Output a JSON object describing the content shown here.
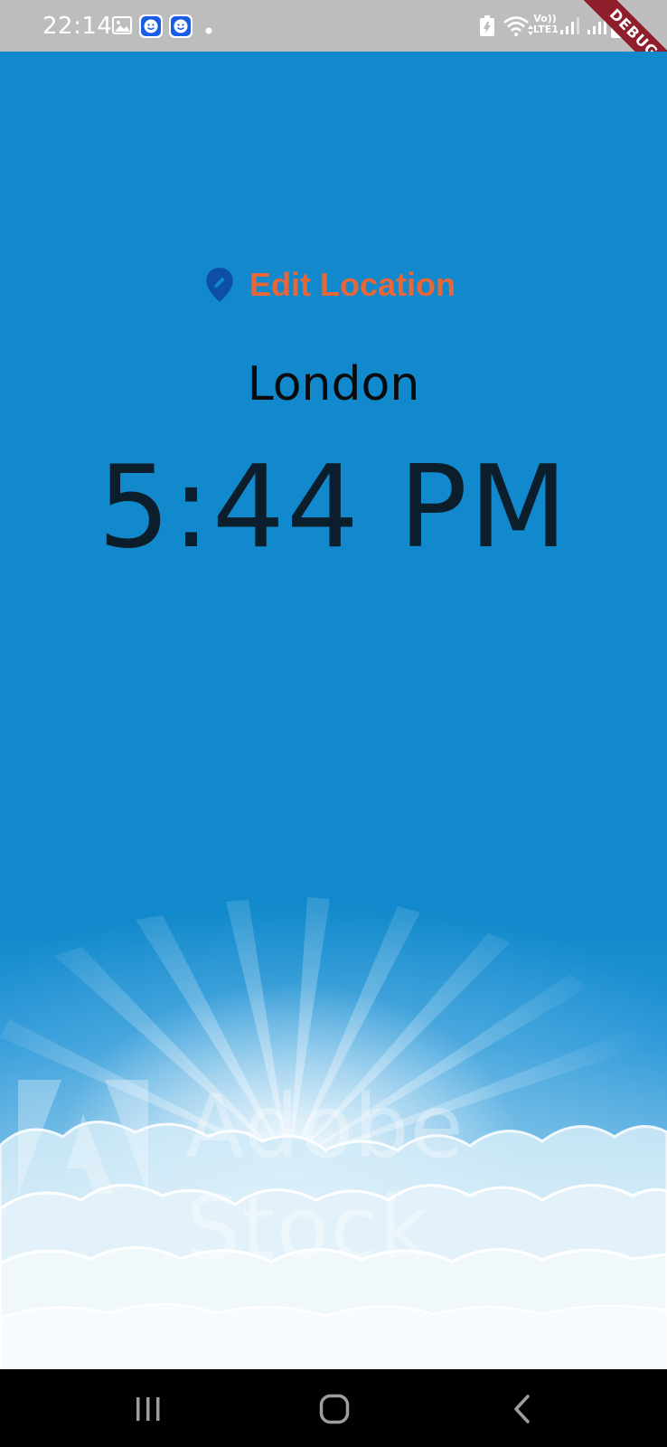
{
  "status_bar": {
    "time": "22:14",
    "icons": [
      "gallery-icon",
      "smile-app-icon",
      "smile-app-icon",
      "dot-icon",
      "battery-saver-icon",
      "wifi-icon",
      "volte-lte1-icon",
      "signal-icon",
      "signal-icon",
      "battery-icon"
    ],
    "volte_label": "Vo))\nLTE1",
    "debug_banner": "DEBUG"
  },
  "main": {
    "edit_location_label": "Edit Location",
    "edit_location_icon": "location-edit-icon",
    "city": "London",
    "time": "5:44 PM",
    "watermark": "Adobe Stock"
  },
  "nav_bar": {
    "recents_icon": "recents-icon",
    "home_icon": "home-icon",
    "back_icon": "back-icon"
  },
  "colors": {
    "background": "#1189CC",
    "edit_location": "#E5673A",
    "pin": "#0D4FA8",
    "time": "#0C1E2C",
    "status_bar": "#BDBDBD",
    "debug_banner": "#8E1E2C"
  }
}
